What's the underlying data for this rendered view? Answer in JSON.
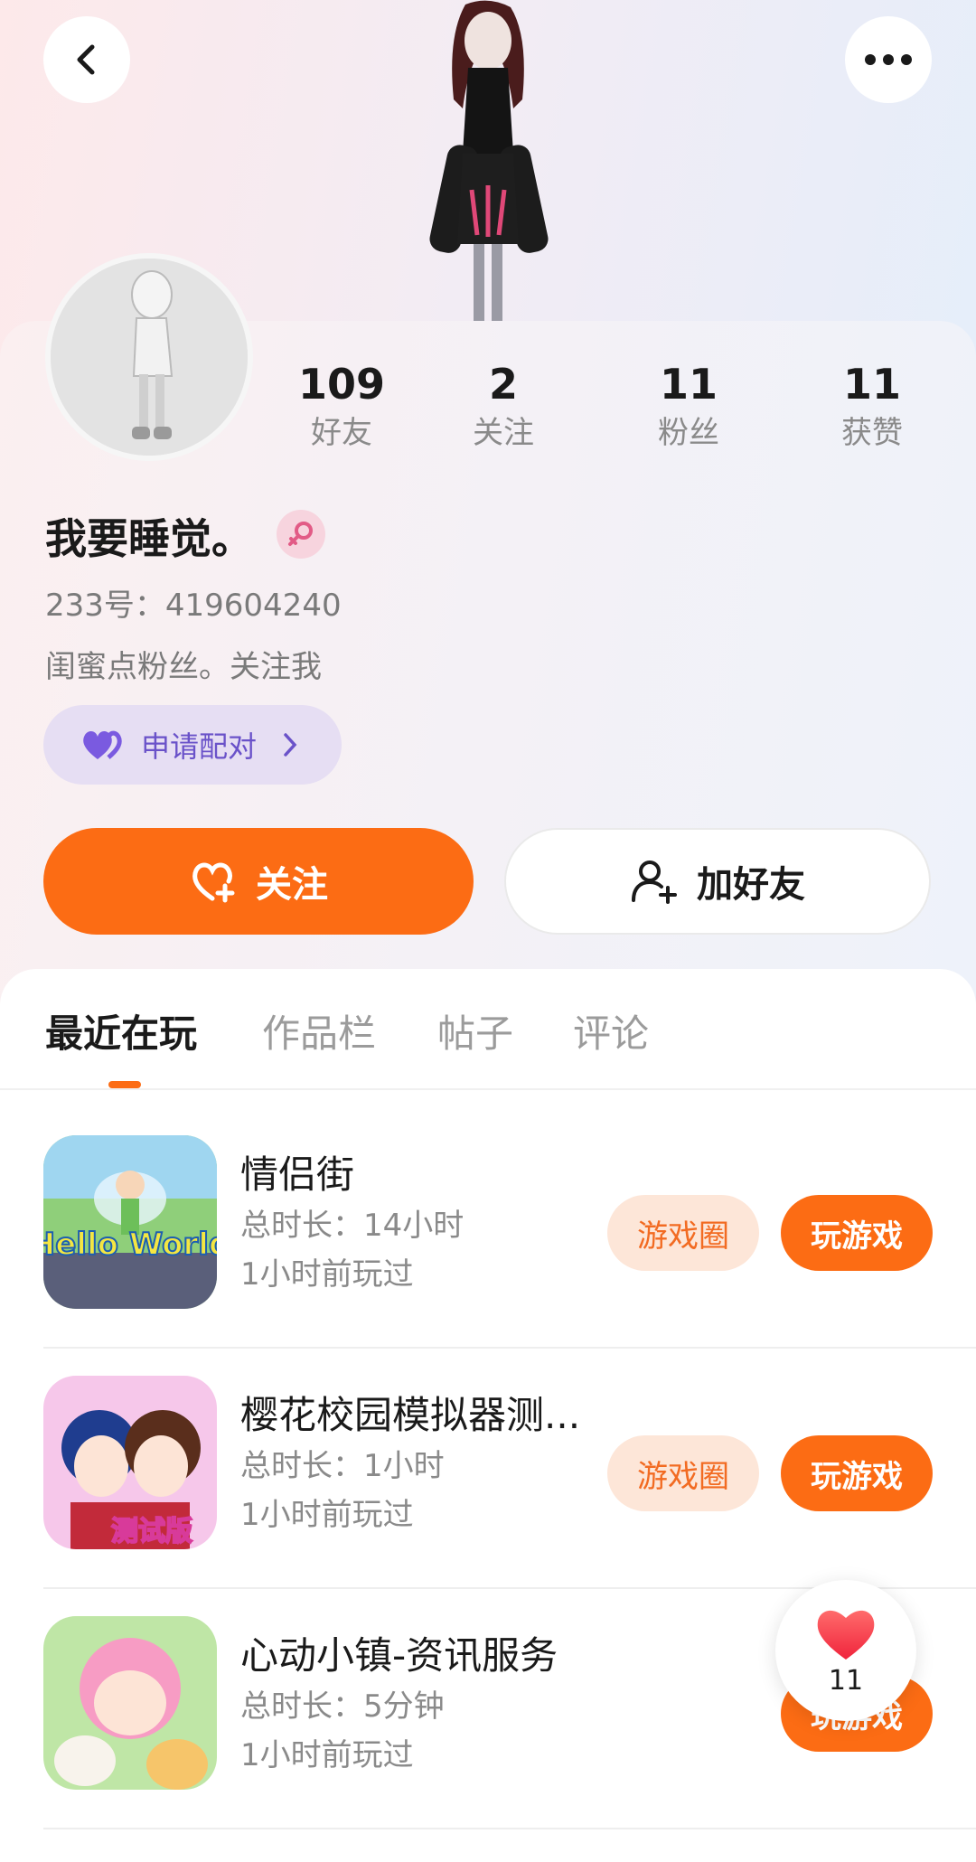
{
  "header": {
    "back_icon": "chevron-left-icon",
    "more_icon": "more-dots-icon"
  },
  "profile": {
    "nickname": "我要睡觉。",
    "gender_icon": "female-icon",
    "uid": "233号：419604240",
    "bio": "闺蜜点粉丝。关注我",
    "pair_button": "申请配对"
  },
  "stats": [
    {
      "value": "109",
      "label": "好友"
    },
    {
      "value": "2",
      "label": "关注"
    },
    {
      "value": "11",
      "label": "粉丝"
    },
    {
      "value": "11",
      "label": "获赞"
    }
  ],
  "actions": {
    "follow": "关注",
    "add_friend": "加好友"
  },
  "tabs": [
    {
      "label": "最近在玩",
      "active": true
    },
    {
      "label": "作品栏",
      "active": false
    },
    {
      "label": "帖子",
      "active": false
    },
    {
      "label": "评论",
      "active": false
    }
  ],
  "games": [
    {
      "title": "情侣街",
      "duration": "总时长：14小时",
      "last_played": "1小时前玩过",
      "circle_label": "游戏圈",
      "play_label": "玩游戏",
      "icon_text": "Hello World"
    },
    {
      "title": "樱花校园模拟器测...",
      "duration": "总时长：1小时",
      "last_played": "1小时前玩过",
      "circle_label": "游戏圈",
      "play_label": "玩游戏",
      "icon_text": "测试版"
    },
    {
      "title": "心动小镇-资讯服务",
      "duration": "总时长：5分钟",
      "last_played": "1小时前玩过",
      "circle_label": "",
      "play_label": "玩游戏",
      "icon_text": ""
    }
  ],
  "like_float": {
    "count": "11",
    "icon": "heart-icon"
  },
  "colors": {
    "accent": "#fc6c14",
    "pair_purple": "#6a52c9",
    "circle_bg": "#fde6d8"
  }
}
